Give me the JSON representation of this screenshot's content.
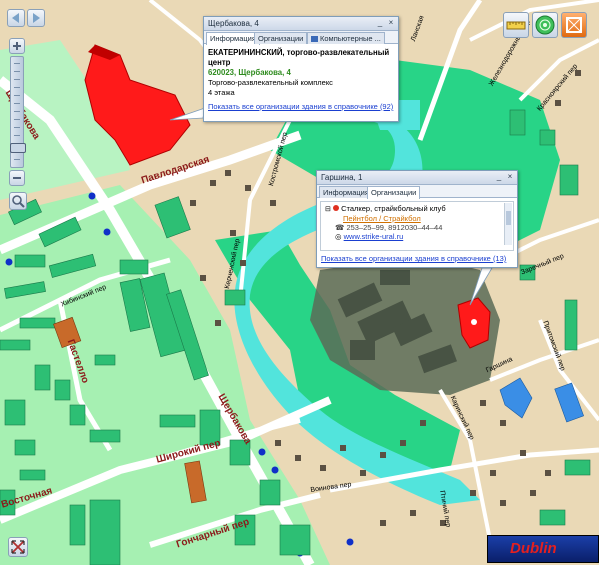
{
  "streets": {
    "shcherbakova_left": "Щербакова",
    "pavlodarskaya": "Павлодарская",
    "gastello": "Гастелло",
    "shirokiy": "Широкий пер",
    "shcherbakova_bottom": "Щербакова",
    "goncharny": "Гончарный пер",
    "vostochnaya": "Восточная",
    "khibinskiy": "Хибинский пер",
    "kerchenskiy": "Керченский пер",
    "kostromskoy": "Костромской пер",
    "voinova": "Воинова пер",
    "ptichiy": "Птичий пер",
    "zhelezno": "Железнодорожный пер",
    "krasnoyar": "Красноярский пер",
    "lanskaya": "Ланская",
    "garshina": "Гаршина",
    "zarechny": "Заречный пер",
    "karinskiy": "Каринский пер",
    "pritomskiy": "Притомский пер"
  },
  "popup1": {
    "title": "Щербакова, 4",
    "tabs": [
      "Информация",
      "Организации",
      "Компьютерные ..."
    ],
    "name_line1": "ЕКАТЕРИНИНСКИЙ, торгово-развлекательный",
    "name_line2": "центр",
    "address": "620023, Щербакова, 4",
    "type": "Торгово-развлекательный комплекс",
    "floors": "4 этажа",
    "link": "Показать все организации здания в справочнике (92)"
  },
  "popup2": {
    "title": "Гаршина, 1",
    "tabs": [
      "Информация",
      "Организации"
    ],
    "org_name": "Сталкер, страйкбольный клуб",
    "org_type": "Пейнтбол / Страйкбол",
    "phones": "253–25–99, 8912030–44–44",
    "site": "www.strike-ural.ru",
    "link": "Показать все организации здания в справочнике (13)"
  },
  "logo": {
    "text": "Dublin"
  },
  "colors": {
    "ground": "#ead9b6",
    "park": "#a6f0b2",
    "forest": "#28d487",
    "water": "#52e4dc",
    "building": "#2dbf74",
    "highlight": "#ff1a1a",
    "brick": "#c86a2a",
    "blue_building": "#3a8ee6",
    "road": "#ffffff",
    "dot": "#1030c8"
  },
  "icons": {
    "nav_back": "arrow-left-icon",
    "nav_forward": "arrow-right-icon",
    "zoom_in": "plus-icon",
    "zoom_out": "minus-icon",
    "search": "magnifier-icon",
    "ruler": "ruler-icon",
    "layers": "radar-icon",
    "print": "frame-icon",
    "fullscreen": "expand-icon"
  }
}
